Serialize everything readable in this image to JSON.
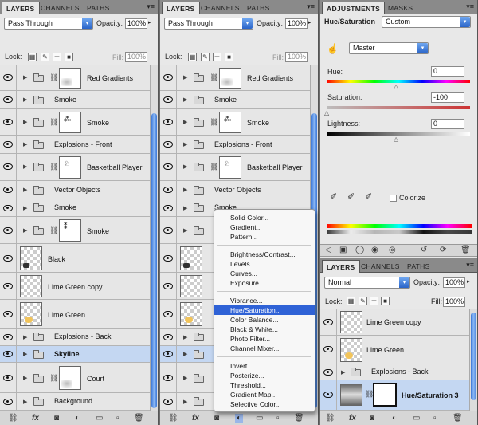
{
  "tabs": {
    "layers": "LAYERS",
    "channels": "CHANNELS",
    "paths": "PATHS",
    "adjustments": "ADJUSTMENTS",
    "masks": "MASKS",
    "menu_glyph": "▾≡"
  },
  "layer_panel": {
    "blend_mode": "Pass Through",
    "opacity_label": "Opacity:",
    "opacity_value": "100%",
    "lock_label": "Lock:",
    "fill_label": "Fill:",
    "fill_value": "100%"
  },
  "panel1_layers": [
    {
      "name": "Red Gradients",
      "type": "group-mask"
    },
    {
      "name": "Smoke",
      "type": "group"
    },
    {
      "name": "Smoke",
      "type": "group-mask"
    },
    {
      "name": "Explosions - Front",
      "type": "group"
    },
    {
      "name": "Basketball Player",
      "type": "group-mask"
    },
    {
      "name": "Vector Objects",
      "type": "group"
    },
    {
      "name": "Smoke",
      "type": "group"
    },
    {
      "name": "Smoke",
      "type": "group-mask"
    },
    {
      "name": "Black",
      "type": "pixel"
    },
    {
      "name": "Lime Green copy",
      "type": "pixel"
    },
    {
      "name": "Lime Green",
      "type": "pixel"
    },
    {
      "name": "Explosions - Back",
      "type": "group"
    },
    {
      "name": "Skyline",
      "type": "group-selected"
    },
    {
      "name": "Court",
      "type": "group-mask"
    },
    {
      "name": "Background",
      "type": "group"
    }
  ],
  "panel2_layers": [
    {
      "name": "Red Gradients"
    },
    {
      "name": "Smoke"
    },
    {
      "name": "Smoke"
    },
    {
      "name": "Explosions - Front"
    },
    {
      "name": "Basketball Player"
    },
    {
      "name": "Vector Objects"
    },
    {
      "name": "Smoke"
    }
  ],
  "menu": {
    "items": [
      "Solid Color...",
      "Gradient...",
      "Pattern...",
      "Brightness/Contrast...",
      "Levels...",
      "Curves...",
      "Exposure...",
      "Vibrance...",
      "Hue/Saturation...",
      "Color Balance...",
      "Black & White...",
      "Photo Filter...",
      "Channel Mixer...",
      "Invert",
      "Posterize...",
      "Threshold...",
      "Gradient Map...",
      "Selective Color..."
    ],
    "highlighted": "Hue/Saturation..."
  },
  "adjustments": {
    "title": "Hue/Saturation",
    "preset": "Custom",
    "channel": "Master",
    "hue_label": "Hue:",
    "hue_value": "0",
    "saturation_label": "Saturation:",
    "saturation_value": "-100",
    "lightness_label": "Lightness:",
    "lightness_value": "0",
    "colorize_label": "Colorize"
  },
  "panel3": {
    "blend_mode": "Normal",
    "opacity_label": "Opacity:",
    "opacity_value": "100%",
    "lock_label": "Lock:",
    "fill_label": "Fill:",
    "fill_value": "100%",
    "layers": [
      {
        "name": "Lime Green copy"
      },
      {
        "name": "Lime Green"
      },
      {
        "name": "Explosions - Back"
      },
      {
        "name": "Hue/Saturation 3"
      }
    ]
  },
  "icons": {
    "link": "⛓",
    "fx": "fx",
    "mask": "◙",
    "adjust": "◐",
    "folder": "▭",
    "new": "▫",
    "trash": "🗑"
  }
}
